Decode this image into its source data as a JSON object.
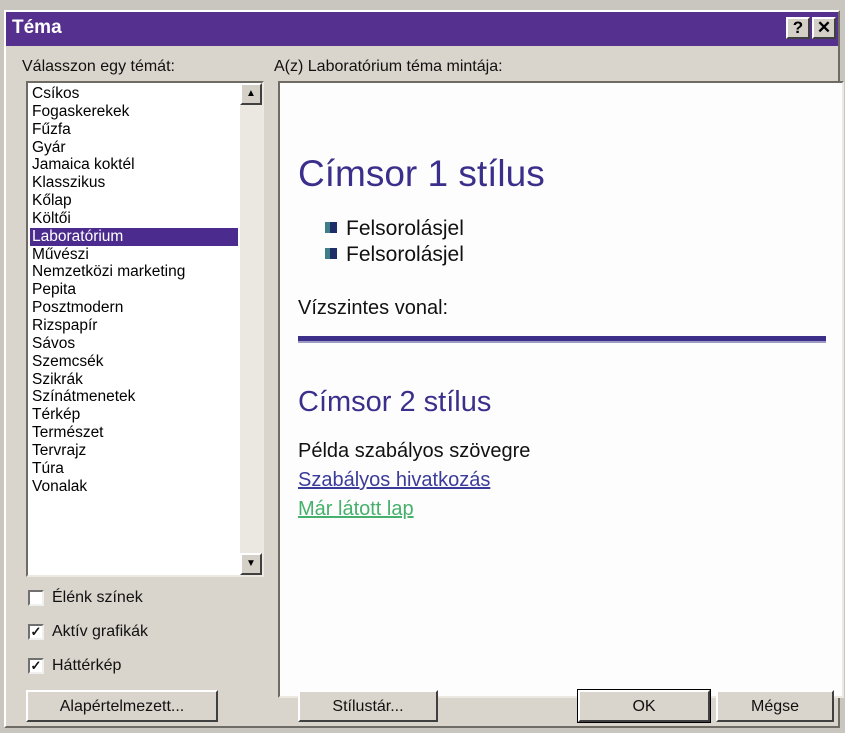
{
  "dialog": {
    "title": "Téma",
    "help_label": "?",
    "close_label": "✕"
  },
  "list": {
    "label": "Válasszon egy témát:",
    "items": [
      "Csíkos",
      "Fogaskerekek",
      "Fűzfa",
      "Gyár",
      "Jamaica koktél",
      "Klasszikus",
      "Kőlap",
      "Költői",
      "Laboratórium",
      "Művészi",
      "Nemzetközi marketing",
      "Pepita",
      "Posztmodern",
      "Rizspapír",
      "Sávos",
      "Szemcsék",
      "Szikrák",
      "Színátmenetek",
      "Térkép",
      "Természet",
      "Tervrajz",
      "Túra",
      "Vonalak"
    ],
    "selected": "Laboratórium"
  },
  "options": {
    "vivid_colors": {
      "label": "Élénk színek",
      "checked": false
    },
    "active_graphics": {
      "label": "Aktív grafikák",
      "checked": true
    },
    "background_image": {
      "label": "Háttérkép",
      "checked": true
    }
  },
  "preview": {
    "label": "A(z) Laboratórium téma mintája:",
    "heading1": "Címsor 1 stílus",
    "bullets": [
      "Felsorolásjel",
      "Felsorolásjel"
    ],
    "hr_label": "Vízszintes vonal:",
    "heading2": "Címsor 2 stílus",
    "body_text": "Példa szabályos szövegre",
    "link_text": "Szabályos hivatkozás",
    "visited_link_text": "Már látott lap"
  },
  "buttons": {
    "default_label": "Alapértelmezett...",
    "style_gallery_label": "Stílustár...",
    "ok_label": "OK",
    "cancel_label": "Mégse"
  },
  "colors": {
    "titlebar": "#55308f",
    "selection": "#4b2b8e",
    "heading": "#3b2f8c",
    "visited_link": "#46b06c"
  }
}
